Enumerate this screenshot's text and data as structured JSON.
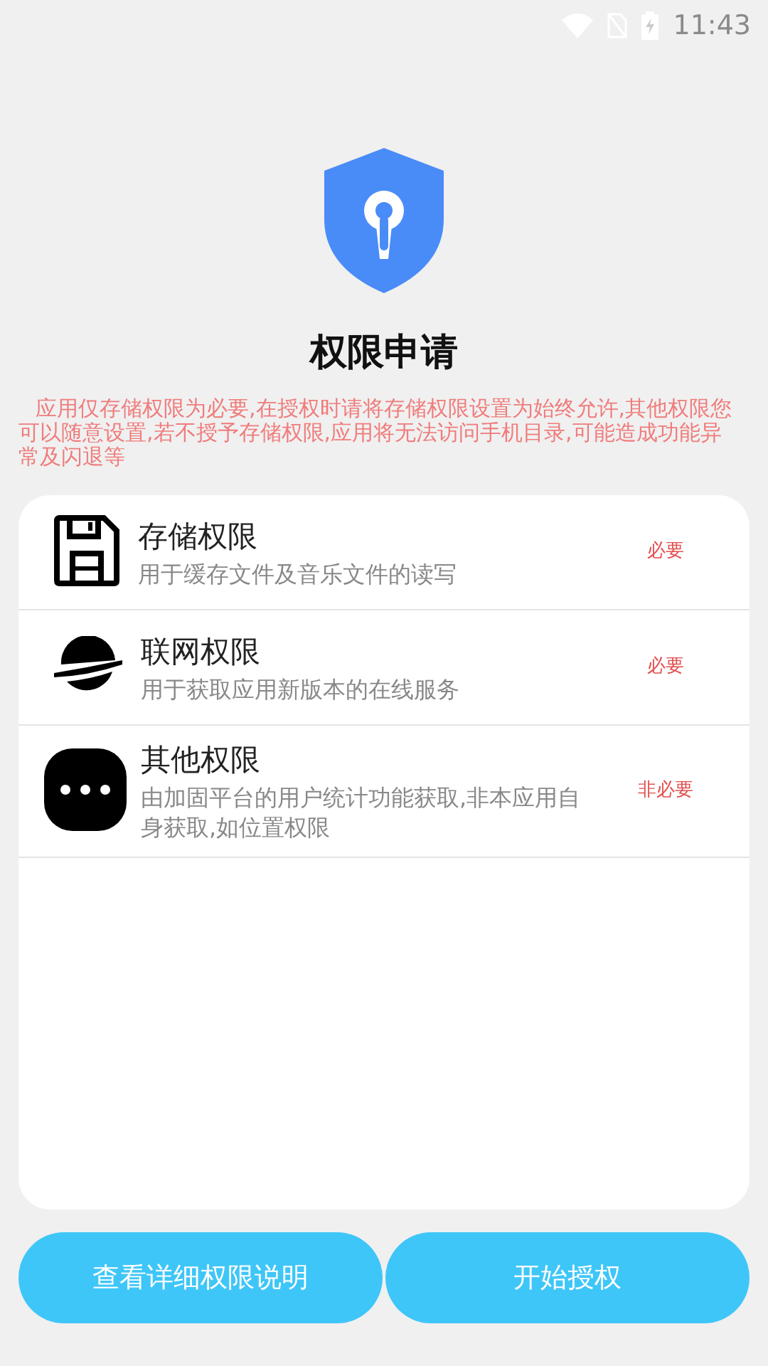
{
  "status_bar": {
    "time": "11:43"
  },
  "title": "权限申请",
  "notice": "应用仅存储权限为必要,在授权时请将存储权限设置为始终允许,其他权限您可以随意设置,若不授予存储权限,应用将无法访问手机目录,可能造成功能异常及闪退等",
  "permissions": [
    {
      "kind": "storage",
      "name": "存储权限",
      "description": "用于缓存文件及音乐文件的读写",
      "tag": "必要"
    },
    {
      "kind": "network",
      "name": "联网权限",
      "description": "用于获取应用新版本的在线服务",
      "tag": "必要"
    },
    {
      "kind": "other",
      "name": "其他权限",
      "description": "由加固平台的用户统计功能获取,非本应用自身获取,如位置权限",
      "tag": "非必要"
    }
  ],
  "buttons": [
    "查看详细权限说明",
    "开始授权"
  ]
}
